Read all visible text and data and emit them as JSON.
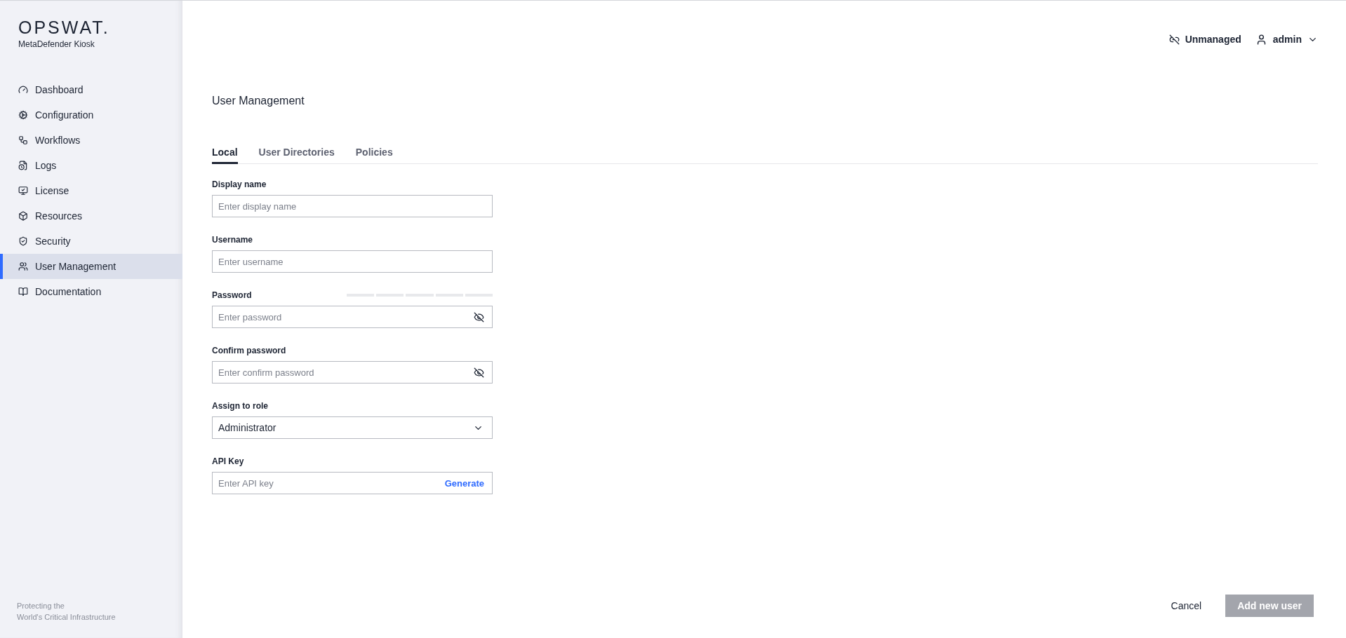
{
  "sidebar": {
    "logo": "OPSWAT.",
    "product": "MetaDefender Kiosk",
    "items": [
      {
        "label": "Dashboard",
        "selected": false
      },
      {
        "label": "Configuration",
        "selected": false
      },
      {
        "label": "Workflows",
        "selected": false
      },
      {
        "label": "Logs",
        "selected": false
      },
      {
        "label": "License",
        "selected": false
      },
      {
        "label": "Resources",
        "selected": false
      },
      {
        "label": "Security",
        "selected": false
      },
      {
        "label": "User Management",
        "selected": true
      },
      {
        "label": "Documentation",
        "selected": false
      }
    ],
    "footer": [
      "Protecting the",
      "World's Critical Infrastructure"
    ]
  },
  "header": {
    "status": "Unmanaged",
    "user": "admin"
  },
  "page_title": "User Management",
  "tabs": [
    {
      "label": "Local",
      "selected": true
    },
    {
      "label": "User Directories",
      "selected": false
    },
    {
      "label": "Policies",
      "selected": false
    }
  ],
  "fields": [
    {
      "kind": "text",
      "label": "Display name",
      "placeholder": "Enter display name"
    },
    {
      "kind": "text",
      "label": "Username",
      "placeholder": "Enter username"
    },
    {
      "kind": "password",
      "label": "Password",
      "placeholder": "Enter password",
      "meter": true
    },
    {
      "kind": "password",
      "label": "Confirm password",
      "placeholder": "Enter confirm password"
    },
    {
      "kind": "select",
      "label": "Assign to role",
      "value": "Administrator"
    },
    {
      "kind": "api",
      "label": "API Key",
      "placeholder": "Enter API key",
      "action": "Generate"
    }
  ],
  "buttons": [
    {
      "label": "Cancel",
      "kind": "secondary",
      "disabled": false
    },
    {
      "label": "Add new user",
      "kind": "primary",
      "disabled": true
    }
  ]
}
